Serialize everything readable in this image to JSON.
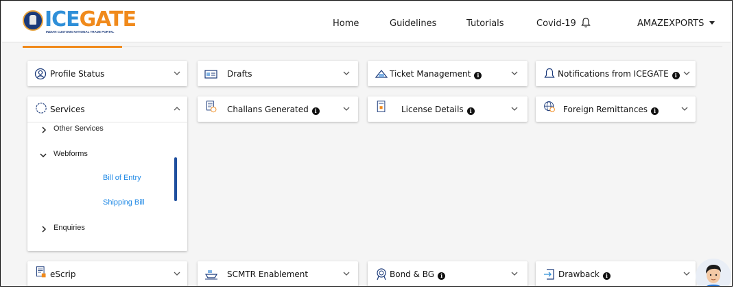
{
  "header": {
    "logo_text_a": "ICE",
    "logo_text_b": "GATE",
    "logo_tagline": "INDIAN CUSTOMS NATIONAL TRADE PORTAL",
    "nav": [
      "Home",
      "Guidelines",
      "Tutorials",
      "Covid-19"
    ],
    "account": "AMAZEXPORTS"
  },
  "cards": {
    "profile_status": "Profile Status",
    "drafts": "Drafts",
    "ticket_management": "Ticket Management",
    "notifications": "Notifications from ICEGATE",
    "services": "Services",
    "challans": "Challans Generated",
    "license": "License Details",
    "foreign": "Foreign Remittances",
    "escrip": "eScrip",
    "scmtr": "SCMTR Enablement",
    "bond": "Bond & BG",
    "drawback": "Drawback"
  },
  "services_menu": {
    "other_services": "Other Services",
    "webforms": "Webforms",
    "bill_of_entry": "Bill of Entry",
    "shipping_bill": "Shipping Bill",
    "enquiries": "Enquiries"
  },
  "colors": {
    "brand_blue": "#2f8fd8",
    "brand_orange": "#f08a1c",
    "link_blue": "#1e88e5",
    "scroll_thumb": "#1f4f9e"
  }
}
